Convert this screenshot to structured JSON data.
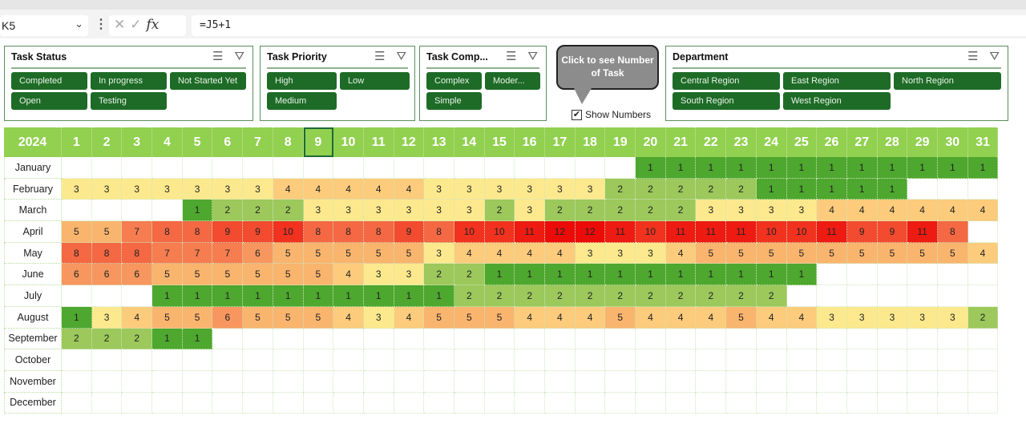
{
  "formula_bar": {
    "cell_ref": "K5",
    "formula": "=J5+1",
    "fx": "fx",
    "cancel": "✕",
    "confirm": "✓"
  },
  "slicers": [
    {
      "title": "Task Status",
      "items": [
        "Completed",
        "In progress",
        "Not Started Yet",
        "Open",
        "Testing"
      ]
    },
    {
      "title": "Task Priority",
      "items": [
        "High",
        "Low",
        "Medium"
      ]
    },
    {
      "title": "Task Comp...",
      "items": [
        "Complex",
        "Moder...",
        "Simple"
      ]
    },
    {
      "title": "Department",
      "items": [
        "Central Region",
        "East Region",
        "North Region",
        "South Region",
        "West Region"
      ]
    }
  ],
  "callout": {
    "text": "Click to see Number of Task"
  },
  "show_numbers": {
    "label": "Show Numbers",
    "checked": true
  },
  "heatmap": {
    "year": "2024",
    "days": [
      "1",
      "2",
      "3",
      "4",
      "5",
      "6",
      "7",
      "8",
      "9",
      "10",
      "11",
      "12",
      "13",
      "14",
      "15",
      "16",
      "17",
      "18",
      "19",
      "20",
      "21",
      "22",
      "23",
      "24",
      "25",
      "26",
      "27",
      "28",
      "29",
      "30",
      "31"
    ],
    "selected_day": "9",
    "months": [
      "January",
      "February",
      "March",
      "April",
      "May",
      "June",
      "July",
      "August",
      "September",
      "October",
      "November",
      "December"
    ],
    "values": [
      [
        null,
        null,
        null,
        null,
        null,
        null,
        null,
        null,
        null,
        null,
        null,
        null,
        null,
        null,
        null,
        null,
        null,
        null,
        null,
        1,
        1,
        1,
        1,
        1,
        1,
        1,
        1,
        1,
        1,
        1,
        1
      ],
      [
        3,
        3,
        3,
        3,
        3,
        3,
        3,
        4,
        4,
        4,
        4,
        4,
        3,
        3,
        3,
        3,
        3,
        3,
        2,
        2,
        2,
        2,
        2,
        1,
        1,
        1,
        1,
        1,
        null,
        null,
        null
      ],
      [
        null,
        null,
        null,
        null,
        1,
        2,
        2,
        2,
        3,
        3,
        3,
        3,
        3,
        3,
        2,
        3,
        2,
        2,
        2,
        2,
        2,
        3,
        3,
        3,
        3,
        4,
        4,
        4,
        4,
        4,
        4
      ],
      [
        5,
        5,
        7,
        8,
        8,
        9,
        9,
        10,
        8,
        8,
        8,
        9,
        8,
        10,
        10,
        11,
        12,
        12,
        11,
        10,
        11,
        11,
        11,
        10,
        10,
        11,
        9,
        9,
        11,
        8,
        null
      ],
      [
        8,
        8,
        8,
        7,
        7,
        7,
        6,
        5,
        5,
        5,
        5,
        5,
        3,
        4,
        4,
        4,
        4,
        3,
        3,
        3,
        4,
        5,
        5,
        5,
        5,
        5,
        5,
        5,
        5,
        5,
        4
      ],
      [
        6,
        6,
        6,
        5,
        5,
        5,
        5,
        5,
        5,
        4,
        3,
        3,
        2,
        2,
        1,
        1,
        1,
        1,
        1,
        1,
        1,
        1,
        1,
        1,
        1,
        null,
        null,
        null,
        null,
        null,
        null
      ],
      [
        null,
        null,
        null,
        1,
        1,
        1,
        1,
        1,
        1,
        1,
        1,
        1,
        1,
        2,
        2,
        2,
        2,
        2,
        2,
        2,
        2,
        2,
        2,
        2,
        null,
        null,
        null,
        null,
        null,
        null,
        null
      ],
      [
        1,
        3,
        4,
        5,
        5,
        6,
        5,
        5,
        5,
        4,
        3,
        4,
        5,
        5,
        5,
        4,
        4,
        4,
        5,
        4,
        4,
        4,
        5,
        4,
        4,
        3,
        3,
        3,
        3,
        3,
        2
      ],
      [
        2,
        2,
        2,
        1,
        1,
        null,
        null,
        null,
        null,
        null,
        null,
        null,
        null,
        null,
        null,
        null,
        null,
        null,
        null,
        null,
        null,
        null,
        null,
        null,
        null,
        null,
        null,
        null,
        null,
        null,
        null
      ],
      [],
      [],
      []
    ],
    "color_scale": {
      "1": "#4ea72e",
      "2": "#9cc85c",
      "3": "#fde98d",
      "4": "#fccb7c",
      "5": "#f9b46e",
      "6": "#f7975f",
      "7": "#f57d50",
      "8": "#f46843",
      "9": "#f24b30",
      "10": "#f0321f",
      "11": "#ed1b12",
      "12": "#eb0c0a"
    },
    "header_color": "#92d050"
  }
}
